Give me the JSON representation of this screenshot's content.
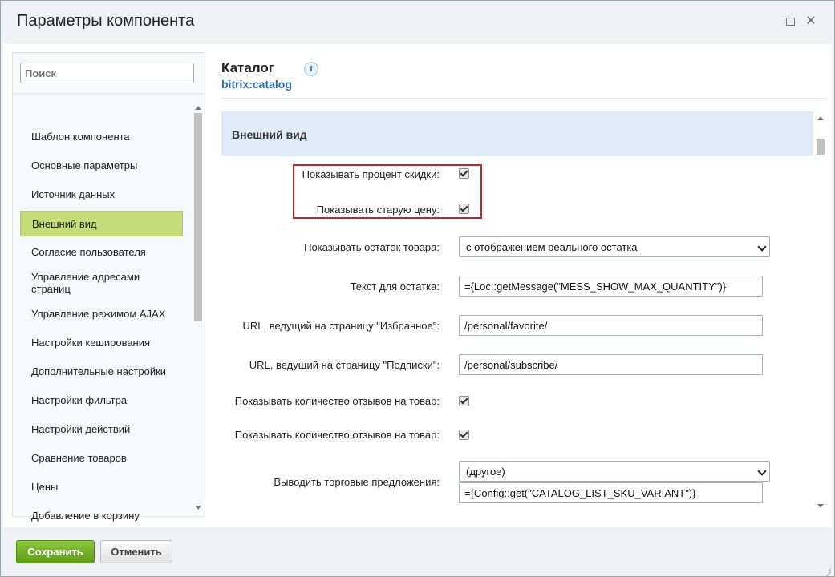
{
  "window": {
    "title": "Параметры компонента",
    "maximize_icon": "maximize-icon",
    "close_icon": "close-icon",
    "close_glyph": "✕"
  },
  "sidebar": {
    "search_placeholder": "Поиск",
    "items": [
      {
        "label": "Шаблон компонента"
      },
      {
        "label": "Основные параметры"
      },
      {
        "label": "Источник данных"
      },
      {
        "label": "Внешний вид",
        "active": true
      },
      {
        "label": "Согласие пользователя"
      },
      {
        "label": "Управление адресами страниц"
      },
      {
        "label": "Управление режимом AJAX"
      },
      {
        "label": "Настройки кеширования"
      },
      {
        "label": "Дополнительные настройки"
      },
      {
        "label": "Настройки фильтра"
      },
      {
        "label": "Настройки действий"
      },
      {
        "label": "Сравнение товаров"
      },
      {
        "label": "Цены"
      },
      {
        "label": "Добавление в корзину"
      }
    ]
  },
  "main": {
    "component_title": "Каталог",
    "component_code": "bitrix:catalog",
    "info_glyph": "i",
    "section_title": "Внешний вид",
    "fields": {
      "show_discount_percent": {
        "label": "Показывать процент скидки:",
        "checked": true
      },
      "show_old_price": {
        "label": "Показывать старую цену:",
        "checked": true
      },
      "show_max_quantity": {
        "label": "Показывать остаток товара:",
        "value": "с отображением реального остатка"
      },
      "quantity_text": {
        "label": "Текст для остатка:",
        "value": "={Loc::getMessage(\"MESS_SHOW_MAX_QUANTITY\")}"
      },
      "favorite_url": {
        "label": "URL, ведущий на страницу \"Избранное\":",
        "value": "/personal/favorite/"
      },
      "subscribe_url": {
        "label": "URL, ведущий на страницу \"Подписки\":",
        "value": "/personal/subscribe/"
      },
      "show_reviews_count_1": {
        "label": "Показывать количество отзывов на товар:",
        "checked": true
      },
      "show_reviews_count_2": {
        "label": "Показывать количество отзывов на товар:",
        "checked": true
      },
      "offers_display": {
        "label": "Выводить торговые предложения:",
        "value": "(другое)",
        "custom_value": "={Config::get(\"CATALOG_LIST_SKU_VARIANT\")}"
      }
    }
  },
  "footer": {
    "save_label": "Сохранить",
    "cancel_label": "Отменить"
  },
  "colors": {
    "active_item_bg": "#c6dc7b",
    "section_head_bg": "#dfebf6",
    "highlight_border": "#c4262e",
    "save_button": "#6aac1f",
    "component_code": "#2a6aa8"
  }
}
